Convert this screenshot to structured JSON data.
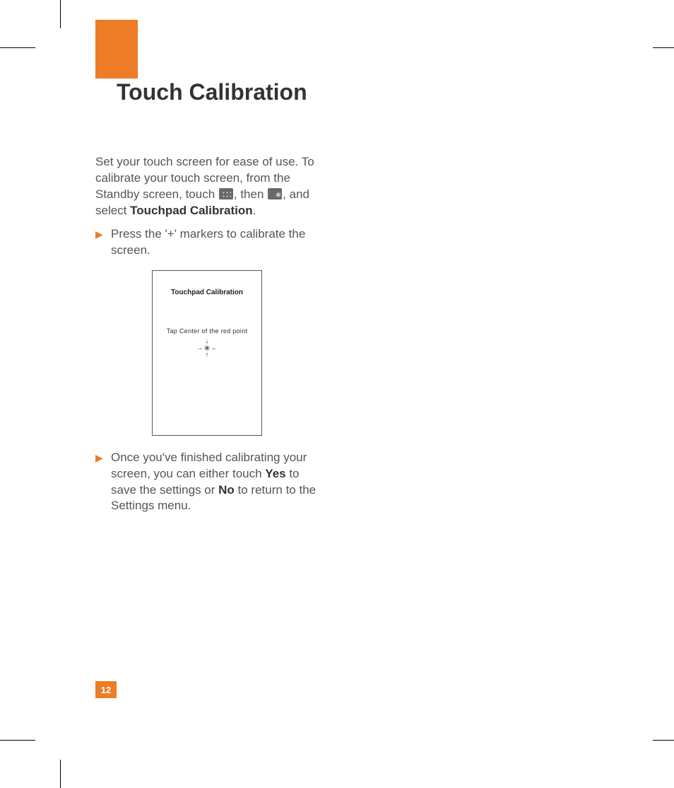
{
  "page_number": "12",
  "title": "Touch Calibration",
  "intro": {
    "pre": "Set your touch screen for ease of use. To calibrate your touch screen, from the Standby screen, touch ",
    "mid": ", then ",
    "post": ", and select ",
    "bold_target": "Touchpad Calibration",
    "period": "."
  },
  "icons": {
    "menu": "app-grid-icon",
    "settings": "settings-gear-icon"
  },
  "bullet1": "Press the '+' markers to calibrate the screen.",
  "figure": {
    "title": "Touchpad Calibration",
    "subtitle": "Tap Center of the red point"
  },
  "bullet2": {
    "a": "Once you've finished calibrating your screen, you can either touch ",
    "yes": "Yes",
    "b": " to save the settings or ",
    "no": "No",
    "c": " to return to the Settings menu."
  }
}
